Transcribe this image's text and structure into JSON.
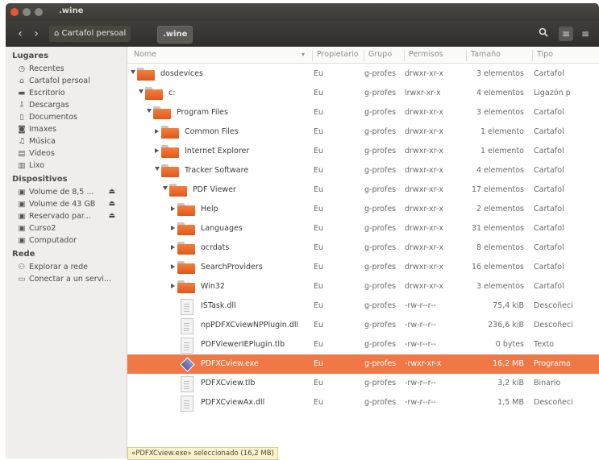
{
  "window": {
    "title": ".wine",
    "button_colors": [
      "#e8552f",
      "#88877f",
      "#88877f"
    ]
  },
  "toolbar": {
    "back_icon": "chevron-left-icon",
    "forward_icon": "chevron-right-icon",
    "breadcrumbs": [
      {
        "label": "Cartafol persoal",
        "icon": "home-icon"
      },
      {
        "label": ".wine"
      }
    ],
    "search_icon": "search-icon",
    "view_icon": "list-view-icon",
    "menu_icon": "menu-icon"
  },
  "sidebar": {
    "sections": [
      {
        "heading": "Lugares",
        "items": [
          {
            "label": "Recentes",
            "icon": "clock-icon"
          },
          {
            "label": "Cartafol persoal",
            "icon": "home-icon"
          },
          {
            "label": "Escritorio",
            "icon": "desktop-icon"
          },
          {
            "label": "Descargas",
            "icon": "download-icon"
          },
          {
            "label": "Documentos",
            "icon": "document-icon"
          },
          {
            "label": "Imaxes",
            "icon": "camera-icon"
          },
          {
            "label": "Música",
            "icon": "music-icon"
          },
          {
            "label": "Vídeos",
            "icon": "film-icon"
          },
          {
            "label": "Lixo",
            "icon": "trash-icon"
          }
        ]
      },
      {
        "heading": "Dispositivos",
        "items": [
          {
            "label": "Volume de 8,5 ...",
            "icon": "drive-icon",
            "eject": true
          },
          {
            "label": "Volume de 43 GB",
            "icon": "drive-icon",
            "eject": true
          },
          {
            "label": "Reservado par...",
            "icon": "drive-icon",
            "eject": true
          },
          {
            "label": "Curso2",
            "icon": "drive-icon"
          },
          {
            "label": "Computador",
            "icon": "drive-icon"
          }
        ]
      },
      {
        "heading": "Rede",
        "items": [
          {
            "label": "Explorar a rede",
            "icon": "network-icon"
          },
          {
            "label": "Conectar a un servi...",
            "icon": "server-icon"
          }
        ]
      }
    ]
  },
  "table": {
    "columns": [
      "Nome",
      "Propietario",
      "Grupo",
      "Permisos",
      "Tamaño",
      "Tipo"
    ],
    "sort_icon": "sort-down-icon",
    "rows": [
      {
        "name": "dosdevices",
        "owner": "Eu",
        "group": "g-profes",
        "perms": "drwxr-xr-x",
        "size": "3 elementos",
        "type": "Cartafol",
        "kind": "folder",
        "depth": 0,
        "expander": "open"
      },
      {
        "name": "c:",
        "owner": "Eu",
        "group": "g-profes",
        "perms": "lrwxr-xr-x",
        "size": "4 elementos",
        "type": "Ligazón p",
        "kind": "folder",
        "depth": 1,
        "expander": "open"
      },
      {
        "name": "Program Files",
        "owner": "Eu",
        "group": "g-profes",
        "perms": "drwxr-xr-x",
        "size": "3 elementos",
        "type": "Cartafol",
        "kind": "folder",
        "depth": 2,
        "expander": "open"
      },
      {
        "name": "Common Files",
        "owner": "Eu",
        "group": "g-profes",
        "perms": "drwxr-xr-x",
        "size": "1 elemento",
        "type": "Cartafol",
        "kind": "folder",
        "depth": 3,
        "expander": "closed"
      },
      {
        "name": "Internet Explorer",
        "owner": "Eu",
        "group": "g-profes",
        "perms": "drwxr-xr-x",
        "size": "1 elemento",
        "type": "Cartafol",
        "kind": "folder",
        "depth": 3,
        "expander": "closed"
      },
      {
        "name": "Tracker Software",
        "owner": "Eu",
        "group": "g-profes",
        "perms": "drwxr-xr-x",
        "size": "4 elementos",
        "type": "Cartafol",
        "kind": "folder",
        "depth": 3,
        "expander": "open"
      },
      {
        "name": "PDF Viewer",
        "owner": "Eu",
        "group": "g-profes",
        "perms": "drwxr-xr-x",
        "size": "17 elementos",
        "type": "Cartafol",
        "kind": "folder",
        "depth": 4,
        "expander": "open"
      },
      {
        "name": "Help",
        "owner": "Eu",
        "group": "g-profes",
        "perms": "drwxr-xr-x",
        "size": "2 elementos",
        "type": "Cartafol",
        "kind": "folder",
        "depth": 5,
        "expander": "closed"
      },
      {
        "name": "Languages",
        "owner": "Eu",
        "group": "g-profes",
        "perms": "drwxr-xr-x",
        "size": "31 elementos",
        "type": "Cartafol",
        "kind": "folder",
        "depth": 5,
        "expander": "closed"
      },
      {
        "name": "ocrdats",
        "owner": "Eu",
        "group": "g-profes",
        "perms": "drwxr-xr-x",
        "size": "8 elementos",
        "type": "Cartafol",
        "kind": "folder",
        "depth": 5,
        "expander": "closed"
      },
      {
        "name": "SearchProviders",
        "owner": "Eu",
        "group": "g-profes",
        "perms": "drwxr-xr-x",
        "size": "16 elementos",
        "type": "Cartafol",
        "kind": "folder",
        "depth": 5,
        "expander": "closed"
      },
      {
        "name": "Win32",
        "owner": "Eu",
        "group": "g-profes",
        "perms": "drwxr-xr-x",
        "size": "3 elementos",
        "type": "Cartafol",
        "kind": "folder",
        "depth": 5,
        "expander": "closed"
      },
      {
        "name": "ISTask.dll",
        "owner": "Eu",
        "group": "g-profes",
        "perms": "-rw-r--r--",
        "size": "75,4 kiB",
        "type": "Descoñeci",
        "kind": "doc",
        "depth": 5
      },
      {
        "name": "npPDFXCviewNPPlugin.dll",
        "owner": "Eu",
        "group": "g-profes",
        "perms": "-rw-r--r--",
        "size": "236,6 kiB",
        "type": "Descoñeci",
        "kind": "doc",
        "depth": 5
      },
      {
        "name": "PDFViewerIEPlugin.tlb",
        "owner": "Eu",
        "group": "g-profes",
        "perms": "-rw-r--r--",
        "size": "0 bytes",
        "type": "Texto",
        "kind": "doc",
        "depth": 5
      },
      {
        "name": "PDFXCview.exe",
        "owner": "Eu",
        "group": "g-profes",
        "perms": "-rwxr-xr-x",
        "size": "16,2 MB",
        "type": "Programa",
        "kind": "exe",
        "depth": 5,
        "selected": true
      },
      {
        "name": "PDFXCview.tlb",
        "owner": "Eu",
        "group": "g-profes",
        "perms": "-rw-r--r--",
        "size": "3,2 kiB",
        "type": "Binario",
        "kind": "doc",
        "depth": 5
      },
      {
        "name": "PDFXCviewAx.dll",
        "owner": "Eu",
        "group": "g-profes",
        "perms": "-rw-r--r--",
        "size": "1,5 MB",
        "type": "Descoñeci",
        "kind": "doc",
        "depth": 5
      }
    ]
  },
  "status": {
    "text": "«PDFXCview.exe» seleccionado (16,2 MB)"
  },
  "colors": {
    "selection": "#f07746",
    "folder": "#e9672a",
    "titlebar": "#3f3e3a"
  }
}
